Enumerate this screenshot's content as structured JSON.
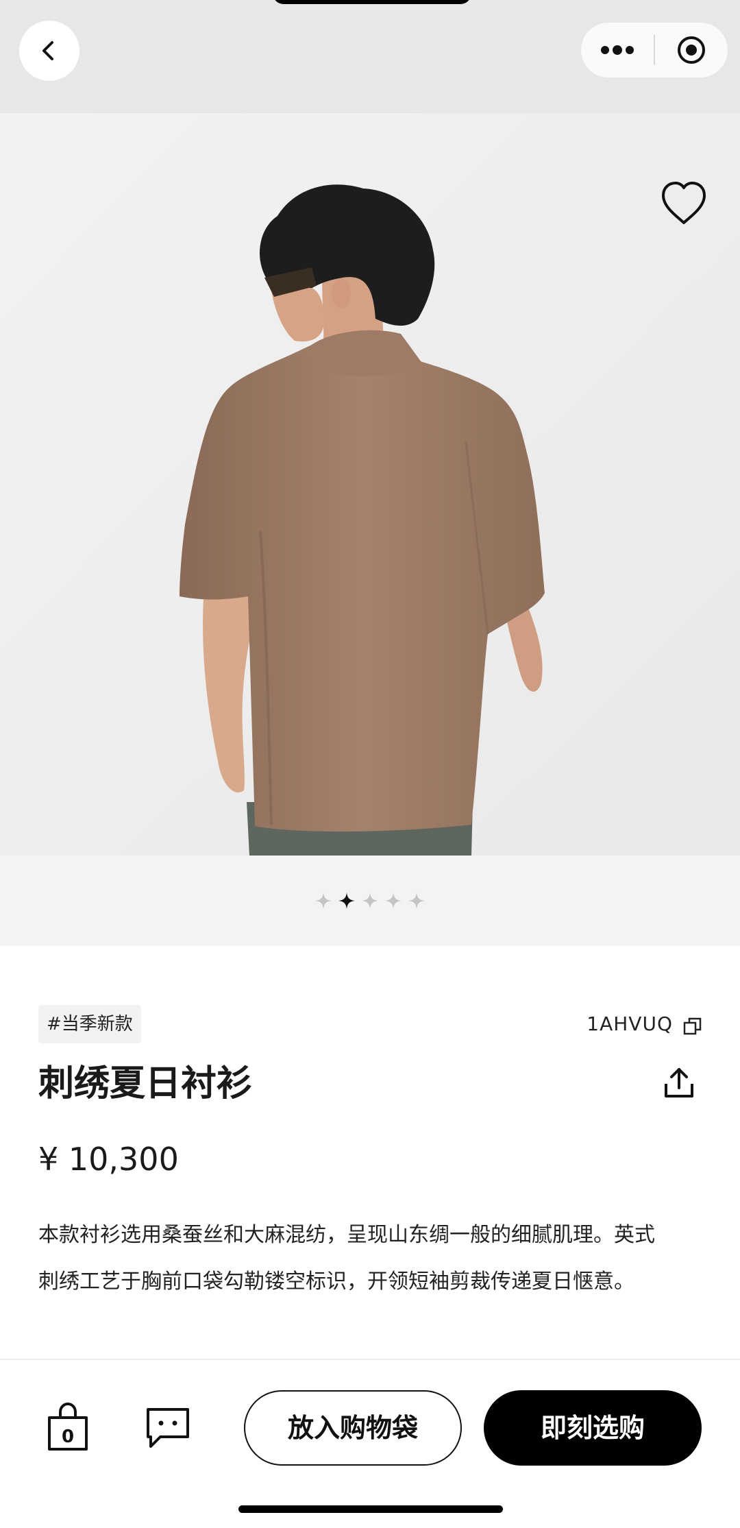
{
  "nav": {
    "back_icon": "chevron-left-icon",
    "more_icon": "more-dots-icon",
    "close_icon": "target-circle-icon"
  },
  "gallery": {
    "image_description_icon": "product-photo",
    "favorite_icon": "heart-outline-icon",
    "page_count": 5,
    "active_index": 1
  },
  "product": {
    "tag": "#当季新款",
    "sku": "1AHVUQ",
    "title": "刺绣夏日衬衫",
    "price": "¥ 10,300",
    "description_line1": "本款衬衫选用桑蚕丝和大麻混纺，呈现山东绸一般的细腻肌理。英式",
    "description_line2": "刺绣工艺于胸前口袋勾勒镂空标识，开领短袖剪裁传递夏日惬意。"
  },
  "actions": {
    "bag_count": "0",
    "add_to_bag_label": "放入购物袋",
    "buy_now_label": "即刻选购"
  },
  "colors": {
    "topbar": "#e7e7e7",
    "shirt": "#9a7a65",
    "primary_button": "#000000"
  }
}
